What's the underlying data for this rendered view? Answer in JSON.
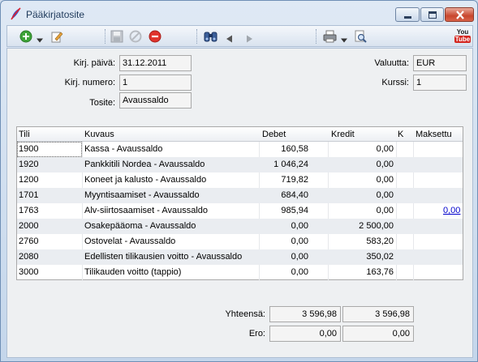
{
  "window": {
    "title": "Pääkirjatosite"
  },
  "toolbar": {
    "icons": [
      "add-icon",
      "dropdown-arrow-icon",
      "edit-icon",
      "save-icon",
      "cancel-icon",
      "delete-icon",
      "find-icon",
      "previous-icon",
      "next-icon",
      "print-icon",
      "dropdown-arrow-icon",
      "print-preview-icon",
      "youtube-icon"
    ],
    "youtube_top": "You",
    "youtube_bottom": "Tube"
  },
  "form": {
    "date_label": "Kirj. päivä:",
    "date_value": "31.12.2011",
    "number_label": "Kirj. numero:",
    "number_value": "1",
    "voucher_label": "Tosite:",
    "voucher_value": "Avaussaldo",
    "currency_label": "Valuutta:",
    "currency_value": "EUR",
    "rate_label": "Kurssi:",
    "rate_value": "1"
  },
  "table": {
    "headers": {
      "tili": "Tili",
      "kuvaus": "Kuvaus",
      "debet": "Debet",
      "kredit": "Kredit",
      "k": "K",
      "maksettu": "Maksettu"
    },
    "rows": [
      {
        "tili": "1900",
        "kuvaus": "Kassa - Avaussaldo",
        "debet": "160,58",
        "kredit": "0,00",
        "maksettu": ""
      },
      {
        "tili": "1920",
        "kuvaus": "Pankkitili Nordea - Avaussaldo",
        "debet": "1 046,24",
        "kredit": "0,00",
        "maksettu": ""
      },
      {
        "tili": "1200",
        "kuvaus": "Koneet ja kalusto - Avaussaldo",
        "debet": "719,82",
        "kredit": "0,00",
        "maksettu": ""
      },
      {
        "tili": "1701",
        "kuvaus": "Myyntisaamiset - Avaussaldo",
        "debet": "684,40",
        "kredit": "0,00",
        "maksettu": ""
      },
      {
        "tili": "1763",
        "kuvaus": "Alv-siirtosaamiset - Avaussaldo",
        "debet": "985,94",
        "kredit": "0,00",
        "maksettu": "0,00"
      },
      {
        "tili": "2000",
        "kuvaus": "Osakepääoma - Avaussaldo",
        "debet": "0,00",
        "kredit": "2 500,00",
        "maksettu": ""
      },
      {
        "tili": "2760",
        "kuvaus": "Ostovelat - Avaussaldo",
        "debet": "0,00",
        "kredit": "583,20",
        "maksettu": ""
      },
      {
        "tili": "2080",
        "kuvaus": "Edellisten tilikausien voitto - Avaussaldo",
        "debet": "0,00",
        "kredit": "350,02",
        "maksettu": ""
      },
      {
        "tili": "3000",
        "kuvaus": "Tilikauden voitto (tappio)",
        "debet": "0,00",
        "kredit": "163,76",
        "maksettu": ""
      }
    ]
  },
  "totals": {
    "total_label": "Yhteensä:",
    "total_debet": "3 596,98",
    "total_kredit": "3 596,98",
    "diff_label": "Ero:",
    "diff_debet": "0,00",
    "diff_kredit": "0,00"
  }
}
